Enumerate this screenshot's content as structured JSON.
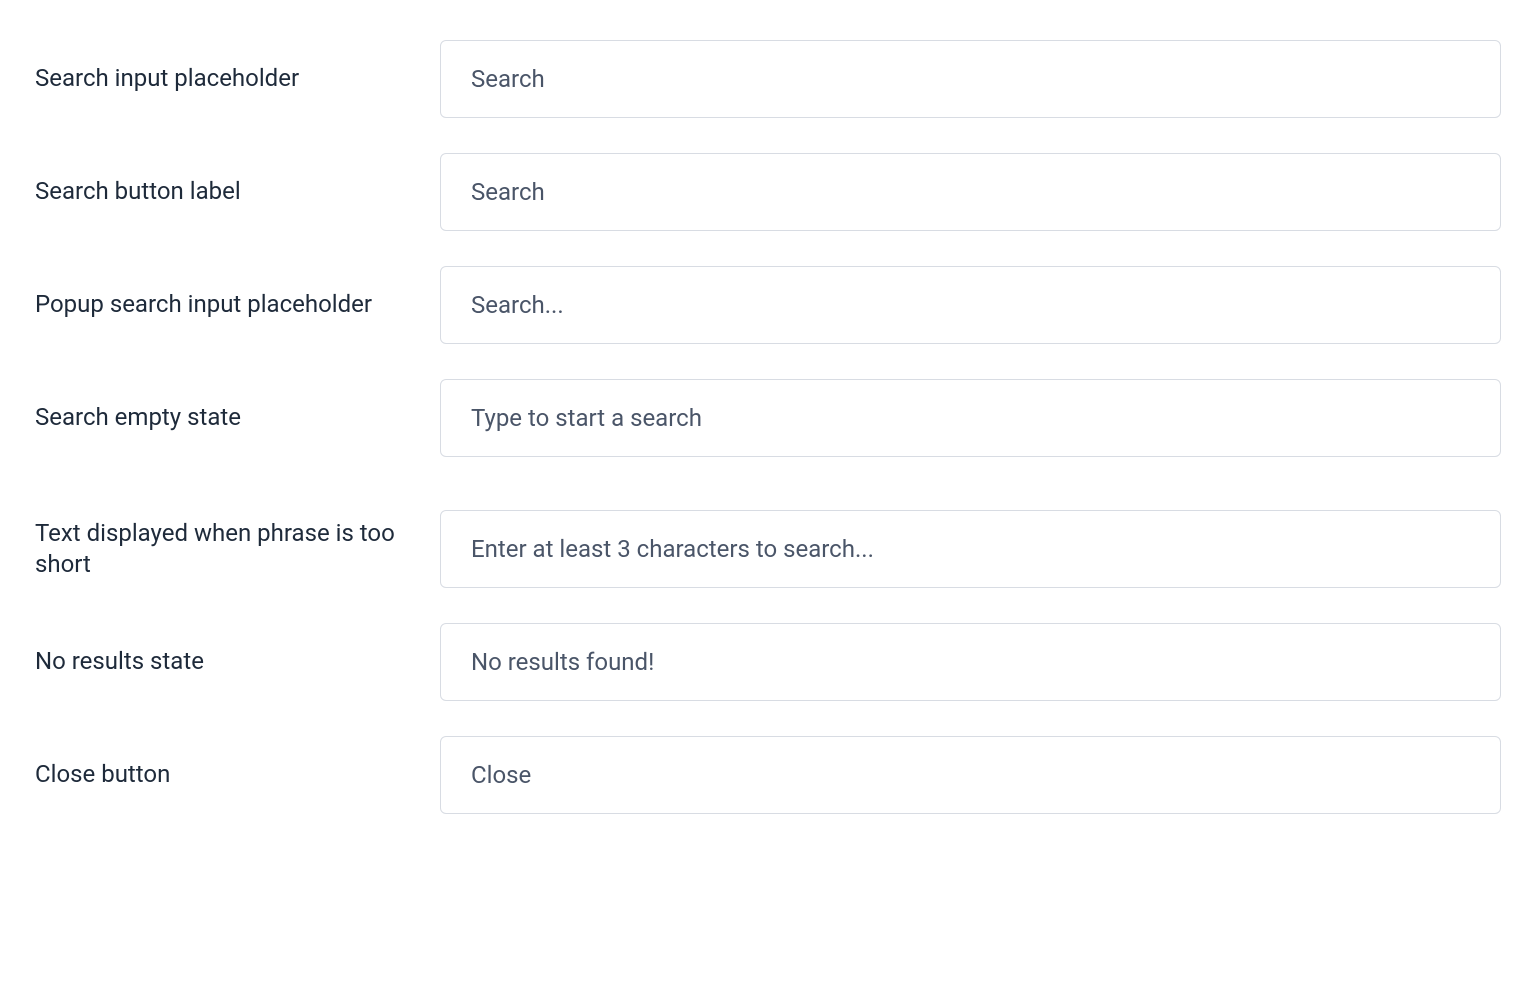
{
  "fields": {
    "searchInputPlaceholder": {
      "label": "Search input placeholder",
      "value": "Search"
    },
    "searchButtonLabel": {
      "label": "Search button label",
      "value": "Search"
    },
    "popupSearchInputPlaceholder": {
      "label": "Popup search input placeholder",
      "value": "Search..."
    },
    "searchEmptyState": {
      "label": "Search empty state",
      "value": "Type to start a search"
    },
    "phraseTooShort": {
      "label": "Text displayed when phrase is too short",
      "value": "Enter at least 3 characters to search..."
    },
    "noResultsState": {
      "label": "No results state",
      "value": "No results found!"
    },
    "closeButton": {
      "label": "Close button",
      "value": "Close"
    }
  }
}
